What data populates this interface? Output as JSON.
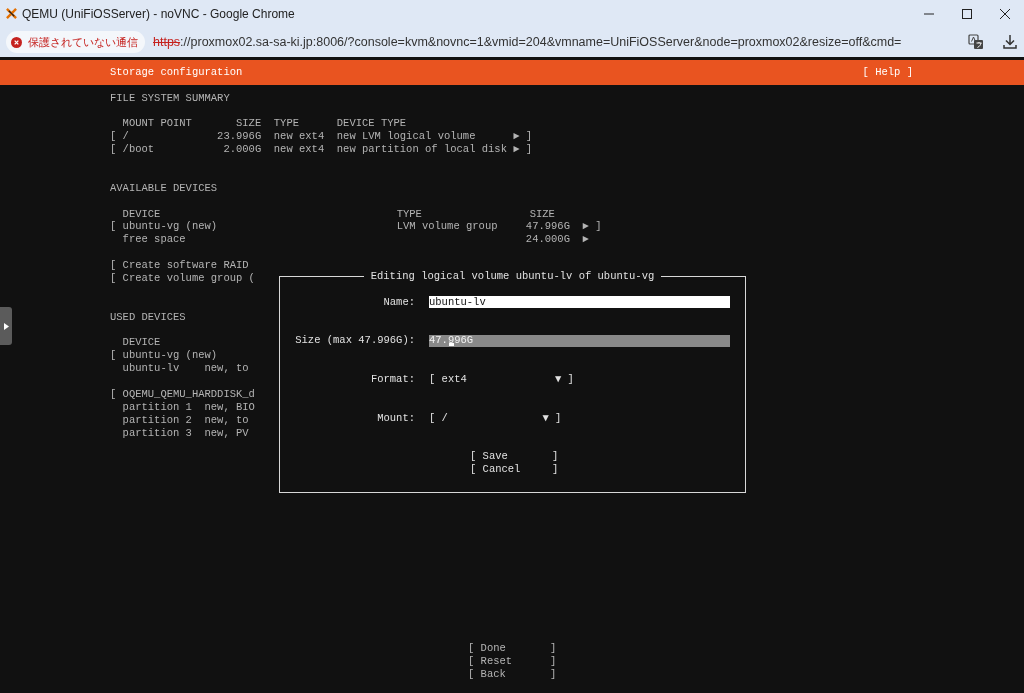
{
  "window": {
    "title": "QEMU (UniFiOSServer) - noVNC - Google Chrome"
  },
  "address_bar": {
    "security_label": "保護されていない通信",
    "url_scheme": "https",
    "url_rest": "://proxmox02.sa-sa-ki.jp:8006/?console=kvm&novnc=1&vmid=204&vmname=UniFiOSServer&node=proxmox02&resize=off&cmd="
  },
  "header": {
    "title": "Storage configuration",
    "help": "[ Help ]"
  },
  "file_system_summary": {
    "title": "FILE SYSTEM SUMMARY",
    "columns": [
      "MOUNT POINT",
      "SIZE",
      "TYPE",
      "DEVICE TYPE"
    ],
    "rows": [
      {
        "bracket_open": "[",
        "mount_point": "/",
        "size": "23.996G",
        "type": "new ext4",
        "device_type": "new LVM logical volume",
        "arrow": "►",
        "bracket_close": "]"
      },
      {
        "bracket_open": "[",
        "mount_point": "/boot",
        "size": "2.000G",
        "type": "new ext4",
        "device_type": "new partition of local disk",
        "arrow": "►",
        "bracket_close": "]"
      }
    ]
  },
  "available_devices": {
    "title": "AVAILABLE DEVICES",
    "columns": [
      "DEVICE",
      "TYPE",
      "SIZE"
    ],
    "rows": [
      {
        "bracket_open": "[",
        "device": "ubuntu-vg (new)",
        "type": "LVM volume group",
        "size": "47.996G",
        "arrow": "►",
        "bracket_close": "]"
      },
      {
        "device": "free space",
        "size": "24.000G",
        "arrow": "►"
      }
    ],
    "actions": [
      "[ Create software RAID",
      "[ Create volume group ("
    ]
  },
  "used_devices": {
    "title": "USED DEVICES",
    "columns": [
      "DEVICE"
    ],
    "groups": [
      [
        {
          "bracket_open": "[",
          "device": "ubuntu-vg (new)"
        },
        {
          "device": "ubuntu-lv",
          "detail": "new, to"
        }
      ],
      [
        {
          "bracket_open": "[",
          "device": "OQEMU_QEMU_HARDDISK_d"
        },
        {
          "device": "partition 1",
          "detail": "new, BIO"
        },
        {
          "device": "partition 2",
          "detail": "new, to"
        },
        {
          "device": "partition 3",
          "detail": "new, PV"
        }
      ]
    ]
  },
  "dialog": {
    "title": "Editing logical volume ubuntu-lv of ubuntu-vg",
    "fields": [
      {
        "kind": "text",
        "label": "Name:",
        "value": "ubuntu-lv",
        "focused": false
      },
      {
        "kind": "text",
        "label": "Size (max 47.996G):",
        "value": "47.996G",
        "focused": true
      },
      {
        "kind": "select",
        "label": "Format:",
        "bracket_open": "[",
        "value": "ext4",
        "arrow": "▼",
        "bracket_close": "]"
      },
      {
        "kind": "select",
        "label": "Mount:",
        "bracket_open": "[",
        "value": "/",
        "arrow": "▼",
        "bracket_close": "]"
      }
    ],
    "buttons": [
      {
        "bracket_open": "[",
        "label": "Save",
        "bracket_close": "]"
      },
      {
        "bracket_open": "[",
        "label": "Cancel",
        "bracket_close": "]"
      }
    ]
  },
  "footer_buttons": [
    {
      "bracket_open": "[",
      "label": "Done",
      "bracket_close": "]"
    },
    {
      "bracket_open": "[",
      "label": "Reset",
      "bracket_close": "]"
    },
    {
      "bracket_open": "[",
      "label": "Back",
      "bracket_close": "]"
    }
  ]
}
